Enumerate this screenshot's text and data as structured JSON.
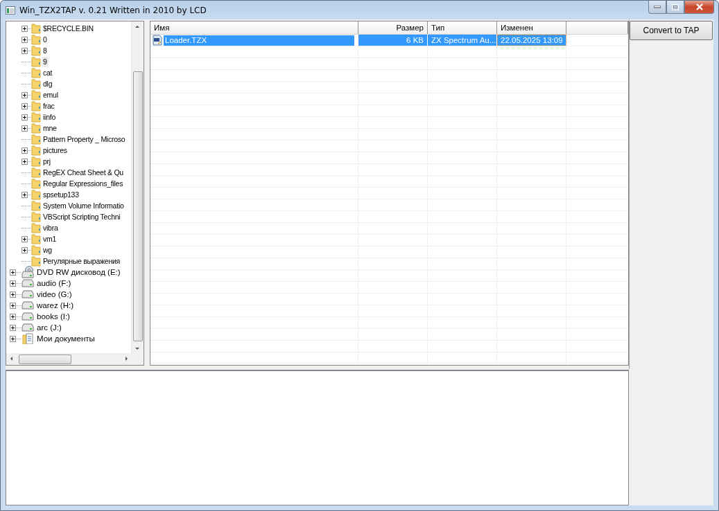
{
  "window": {
    "title": "Win_TZX2TAP v. 0.21 Written in 2010 by LCD"
  },
  "tree": {
    "scrolled_children": [
      {
        "label": "$RECYCLE.BIN",
        "expandable": true,
        "selected": false
      },
      {
        "label": "0",
        "expandable": true,
        "selected": false
      },
      {
        "label": "8",
        "expandable": true,
        "selected": false
      },
      {
        "label": "9",
        "expandable": false,
        "selected": true
      },
      {
        "label": "cat",
        "expandable": false,
        "selected": false
      },
      {
        "label": "dlg",
        "expandable": false,
        "selected": false
      },
      {
        "label": "emul",
        "expandable": true,
        "selected": false
      },
      {
        "label": "frac",
        "expandable": true,
        "selected": false
      },
      {
        "label": "iinfo",
        "expandable": true,
        "selected": false
      },
      {
        "label": "mne",
        "expandable": true,
        "selected": false
      },
      {
        "label": "Pattern Property _ Microso",
        "expandable": false,
        "selected": false
      },
      {
        "label": "pictures",
        "expandable": true,
        "selected": false
      },
      {
        "label": "prj",
        "expandable": true,
        "selected": false
      },
      {
        "label": "RegEX Cheat Sheet & Qu",
        "expandable": false,
        "selected": false
      },
      {
        "label": "Regular Expressions_files",
        "expandable": false,
        "selected": false
      },
      {
        "label": "spsetup133",
        "expandable": true,
        "selected": false
      },
      {
        "label": "System Volume Informatio",
        "expandable": false,
        "selected": false
      },
      {
        "label": "VBScript Scripting Techni",
        "expandable": false,
        "selected": false
      },
      {
        "label": "vibra",
        "expandable": false,
        "selected": false
      },
      {
        "label": "vm1",
        "expandable": true,
        "selected": false
      },
      {
        "label": "wg",
        "expandable": true,
        "selected": false
      },
      {
        "label": "Регулярные выражения",
        "expandable": false,
        "selected": false
      }
    ],
    "items": [
      {
        "label": "DVD RW дисковод (E:)",
        "kind": "dvd",
        "expandable": true,
        "selected": false
      },
      {
        "label": "audio (F:)",
        "kind": "drive",
        "expandable": true,
        "selected": false
      },
      {
        "label": "video (G:)",
        "kind": "drive",
        "expandable": true,
        "selected": false
      },
      {
        "label": "warez (H:)",
        "kind": "drive",
        "expandable": true,
        "selected": false
      },
      {
        "label": "books (I:)",
        "kind": "drive",
        "expandable": true,
        "selected": false
      },
      {
        "label": "arc (J:)",
        "kind": "drive",
        "expandable": true,
        "selected": false
      },
      {
        "label": "Мои документы",
        "kind": "documents",
        "expandable": true,
        "selected": false
      }
    ]
  },
  "file_list": {
    "columns": [
      "Имя",
      "Размер",
      "Тип",
      "Изменен"
    ],
    "rows": [
      {
        "cells": [
          "Loader.TZX",
          "6 KB",
          "ZX Spectrum Au...",
          "22.05.2025 13:09"
        ],
        "selected": true
      }
    ]
  },
  "buttons": [
    "Convert to TAP"
  ]
}
